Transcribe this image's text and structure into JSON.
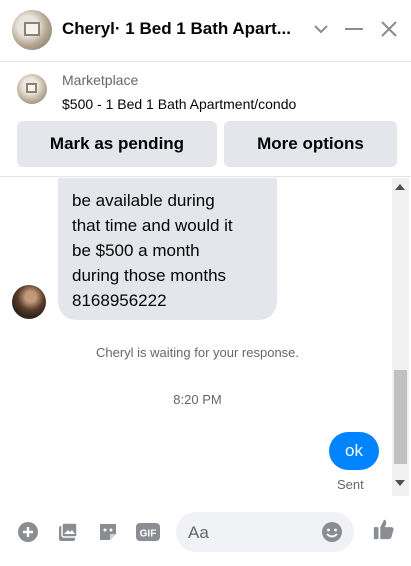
{
  "header": {
    "title": "Cheryl· 1 Bed 1 Bath Apart...",
    "icons": [
      "chevron-down-icon",
      "minimize-icon",
      "close-icon"
    ]
  },
  "listing": {
    "label": "Marketplace",
    "item": "$500 - 1 Bed 1 Bath Apartment/condo",
    "buttons": {
      "pending": "Mark as pending",
      "more": "More options"
    }
  },
  "thread": {
    "incoming_text": "be available during\nthat time and would it\nbe $500 a month\nduring those months\n8168956222",
    "status": "Cheryl is waiting for your response.",
    "time": "8:20 PM",
    "outgoing_text": "ok",
    "sent_label": "Sent"
  },
  "composer": {
    "placeholder": "Aa",
    "icons": [
      "plus-icon",
      "image-icon",
      "sticker-icon",
      "gif-icon",
      "emoji-icon",
      "thumbs-up-icon"
    ]
  },
  "colors": {
    "accent": "#0084ff",
    "icon": "#8a8d91",
    "bubble_in": "#e4e6eb"
  }
}
